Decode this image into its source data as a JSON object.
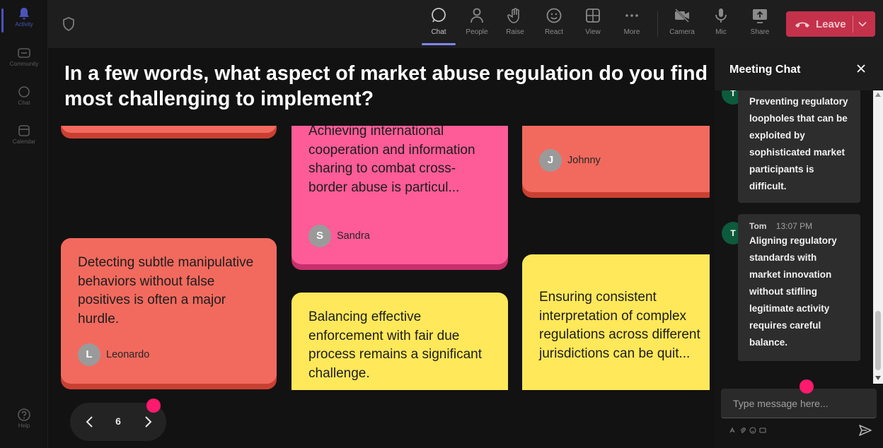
{
  "rail": {
    "items": [
      {
        "label": "Activity",
        "active": true
      },
      {
        "label": "Community"
      },
      {
        "label": "Chat"
      },
      {
        "label": "Calendar"
      },
      {
        "label": "Help"
      }
    ]
  },
  "toolbar": {
    "chat": "Chat",
    "people": "People",
    "raise": "Raise",
    "react": "React",
    "view": "View",
    "more": "More",
    "camera": "Camera",
    "mic": "Mic",
    "share": "Share",
    "leave": "Leave"
  },
  "stage": {
    "question": "In a few words, what aspect of market abuse regulation do you find most challenging to implement?",
    "cards": [
      {
        "text": "",
        "author": "",
        "initial": ""
      },
      {
        "text": "Achieving international cooperation and information sharing to combat cross-border abuse is particul...",
        "author": "Sandra",
        "initial": "S"
      },
      {
        "text": "",
        "author": "Johnny",
        "initial": "J"
      },
      {
        "text": "Detecting subtle manipulative behaviors without false positives is often a major hurdle.",
        "author": "Leonardo",
        "initial": "L"
      },
      {
        "text": "Balancing effective enforcement with fair due process remains a significant challenge.",
        "author": "",
        "initial": ""
      },
      {
        "text": "Ensuring consistent interpretation of complex regulations across different jurisdictions can be quit...",
        "author": "",
        "initial": ""
      }
    ],
    "page": "6"
  },
  "chat": {
    "title": "Meeting Chat",
    "messages": [
      {
        "initial": "T",
        "text": "Preventing regulatory loopholes that can be exploited by sophisticated market participants is difficult."
      },
      {
        "initial": "T",
        "name": "Tom",
        "time": "13:07 PM",
        "text": "Aligning regulatory standards with market innovation without stifling legitimate activity requires careful balance."
      }
    ],
    "placeholder": "Type message here..."
  },
  "colors": {
    "card_red": "#f26a5e",
    "card_pink": "#fd5c98",
    "card_yellow": "#ffe85a",
    "leave_red": "#c4314b",
    "accent": "#7f85f5",
    "cursor_dot": "#ff1a6e"
  }
}
